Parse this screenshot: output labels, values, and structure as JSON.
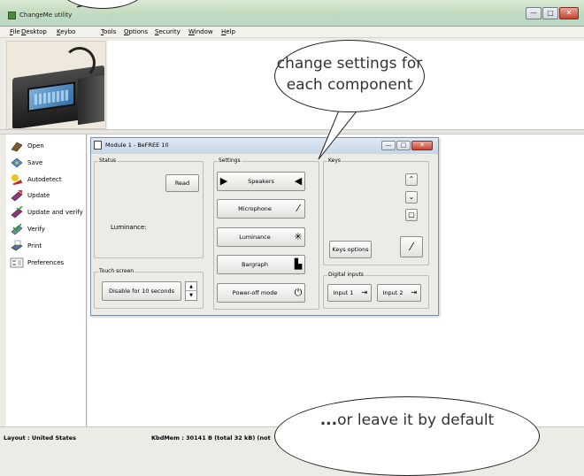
{
  "window": {
    "title": "ChangeMe utility",
    "min": "—",
    "max": "□",
    "close": "✕"
  },
  "menu": [
    "File",
    "Desktop",
    "Keybo",
    "Tools",
    "Options",
    "Security",
    "Window",
    "Help"
  ],
  "sidebar": {
    "items": [
      {
        "label": "Open",
        "icon": "open-icon"
      },
      {
        "label": "Save",
        "icon": "save-icon"
      },
      {
        "label": "Autodetect",
        "icon": "autodetect-icon"
      },
      {
        "label": "Update",
        "icon": "update-icon"
      },
      {
        "label": "Update and verify",
        "icon": "update-verify-icon"
      },
      {
        "label": "Verify",
        "icon": "verify-icon"
      },
      {
        "label": "Print",
        "icon": "print-icon"
      },
      {
        "label": "Preferences",
        "icon": "preferences-icon"
      }
    ]
  },
  "dialog": {
    "title": "Module 1 - BeFREE 10",
    "min": "—",
    "max": "□",
    "close": "✕",
    "status": {
      "label": "Status",
      "read_button": "Read",
      "luminance_label": "Luminance:"
    },
    "touch": {
      "label": "Touch screen",
      "button": "Disable for 10 seconds",
      "up": "▲",
      "down": "▼"
    },
    "settings": {
      "label": "Settings",
      "buttons": [
        {
          "label": "Speakers",
          "icon": "speaker-icon"
        },
        {
          "label": "Microphone",
          "icon": "microphone-icon"
        },
        {
          "label": "Luminance",
          "icon": "brightness-icon"
        },
        {
          "label": "Bargraph",
          "icon": "bargraph-icon"
        },
        {
          "label": "Power-off mode",
          "icon": "power-icon"
        }
      ]
    },
    "keys": {
      "label": "Keys",
      "up": "⌃",
      "down": "⌄",
      "square": "▢",
      "options_button": "Keys options"
    },
    "digital": {
      "label": "Digital inputs",
      "input1": "Input 1",
      "input2": "Input 2"
    }
  },
  "status_bar": {
    "layout": "Layout : United States",
    "mem": "KbdMem : 30141 B   (total 32 kB) (not"
  },
  "callouts": {
    "top": "change settings for\neach component",
    "bottom_prefix": "...",
    "bottom": "or leave it by default"
  },
  "colors": {
    "titlebar": "#c3dcc0",
    "close": "#c7422f",
    "dialog_title": "#c6d7e8"
  }
}
